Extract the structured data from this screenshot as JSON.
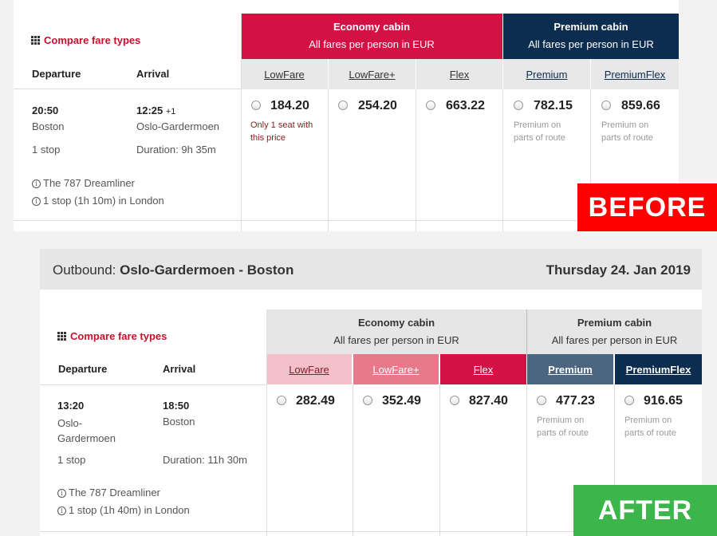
{
  "before": {
    "compare_label": "Compare fare types",
    "col_departure": "Departure",
    "col_arrival": "Arrival",
    "economy": {
      "title": "Economy cabin",
      "subtitle": "All fares per person in EUR"
    },
    "premium": {
      "title": "Premium cabin",
      "subtitle": "All fares per person in EUR"
    },
    "fares": [
      {
        "name": "LowFare",
        "price": "184.20",
        "note": [
          "Only 1 seat with",
          "this price"
        ]
      },
      {
        "name": "LowFare+",
        "price": "254.20",
        "note": []
      },
      {
        "name": "Flex",
        "price": "663.22",
        "note": []
      },
      {
        "name": "Premium",
        "price": "782.15",
        "note": [
          "Premium on",
          "parts of route"
        ]
      },
      {
        "name": "PremiumFlex",
        "price": "859.66",
        "note": [
          "Premium on",
          "parts of route"
        ]
      }
    ],
    "flight": {
      "dep_time": "20:50",
      "dep_city": "Boston",
      "arr_time": "12:25",
      "arr_offset": "+1",
      "arr_city": "Oslo-Gardermoen",
      "stops": "1 stop",
      "duration": "Duration: 9h 35m",
      "aircraft": "The 787 Dreamliner",
      "layover": "1 stop (1h 10m) in London"
    },
    "colors": {
      "economy": "#d31145",
      "premium": "#0b2d4f"
    }
  },
  "after": {
    "outbound_label": "Outbound:",
    "route": "Oslo-Gardermoen - Boston",
    "date": "Thursday 24. Jan 2019",
    "compare_label": "Compare fare types",
    "col_departure": "Departure",
    "col_arrival": "Arrival",
    "economy": {
      "title": "Economy cabin",
      "subtitle": "All fares per person in EUR"
    },
    "premium": {
      "title": "Premium cabin",
      "subtitle": "All fares per person in EUR"
    },
    "fares": [
      {
        "name": "LowFare",
        "price": "282.49",
        "note": []
      },
      {
        "name": "LowFare+",
        "price": "352.49",
        "note": []
      },
      {
        "name": "Flex",
        "price": "827.40",
        "note": []
      },
      {
        "name": "Premium",
        "price": "477.23",
        "note": [
          "Premium on",
          "parts of route"
        ]
      },
      {
        "name": "PremiumFlex",
        "price": "916.65",
        "note": [
          "Premium on",
          "parts of route"
        ]
      }
    ],
    "flight": {
      "dep_time": "13:20",
      "dep_city_1": "Oslo-",
      "dep_city_2": "Gardermoen",
      "arr_time": "18:50",
      "arr_city": "Boston",
      "stops": "1 stop",
      "duration": "Duration: 11h 30m",
      "aircraft": "The 787 Dreamliner",
      "layover": "1 stop (1h 40m) in London"
    },
    "colors": {
      "tab1": "#f2c1c9",
      "tab2": "#e8798a",
      "tab3": "#d31145",
      "tab4": "#4a6680",
      "tab5": "#0b2d4f"
    }
  },
  "stamps": {
    "before": "BEFORE",
    "after": "AFTER"
  }
}
